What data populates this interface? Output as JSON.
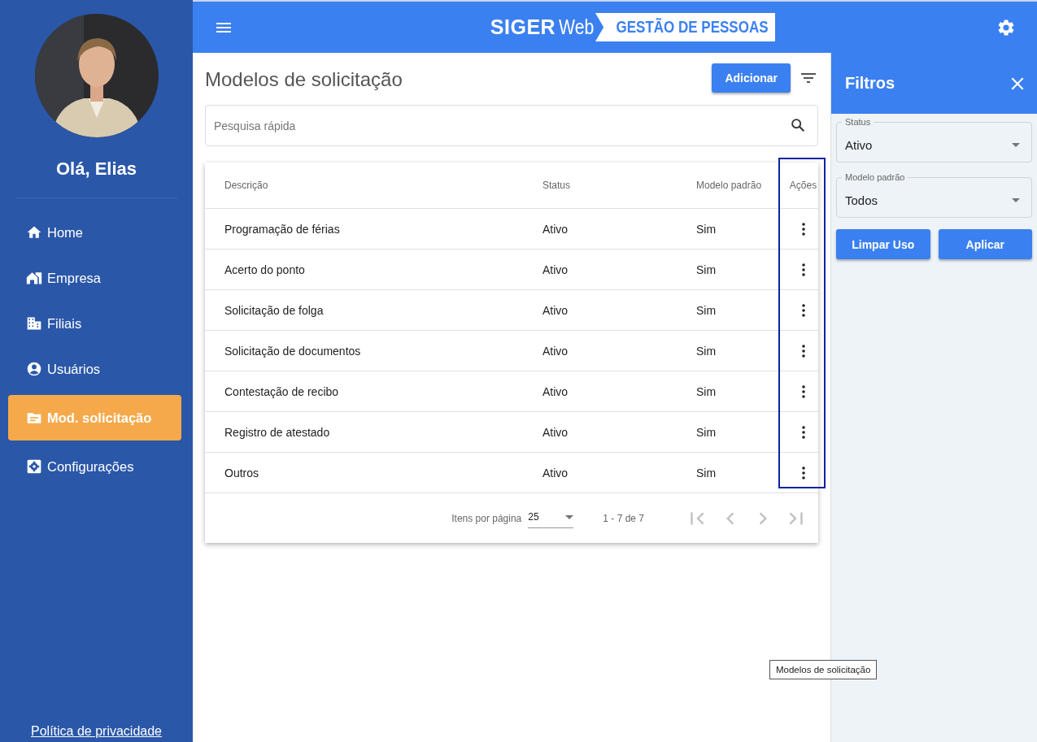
{
  "sidebar": {
    "greeting": "Olá, Elias",
    "items": [
      {
        "label": "Home",
        "selected": false
      },
      {
        "label": "Empresa",
        "selected": false
      },
      {
        "label": "Filiais",
        "selected": false
      },
      {
        "label": "Usuários",
        "selected": false
      },
      {
        "label": "Mod. solicitação",
        "selected": true
      },
      {
        "label": "Configurações",
        "selected": false
      }
    ],
    "footer_link": "Política de privacidade"
  },
  "header": {
    "brand": "SIGER",
    "brand_suffix": "Web",
    "product": "GESTÃO DE PESSOAS"
  },
  "page": {
    "title": "Modelos de solicitação",
    "add_button": "Adicionar",
    "search": {
      "placeholder": "Pesquisa rápida"
    }
  },
  "table": {
    "columns": [
      "Descrição",
      "Status",
      "Modelo padrão",
      "Ações"
    ],
    "rows": [
      [
        "Programação de férias",
        "Ativo",
        "Sim"
      ],
      [
        "Acerto do ponto",
        "Ativo",
        "Sim"
      ],
      [
        "Solicitação de folga",
        "Ativo",
        "Sim"
      ],
      [
        "Solicitação de documentos",
        "Ativo",
        "Sim"
      ],
      [
        "Contestação de recibo",
        "Ativo",
        "Sim"
      ],
      [
        "Registro de atestado",
        "Ativo",
        "Sim"
      ],
      [
        "Outros",
        "Ativo",
        "Sim"
      ]
    ],
    "paginator": {
      "page_size_label": "Itens por página",
      "page_size": "25",
      "range": "1 - 7 de 7"
    }
  },
  "filters": {
    "title": "Filtros",
    "fields": [
      {
        "label": "Status",
        "value": "Ativo"
      },
      {
        "label": "Modelo padrão",
        "value": "Todos"
      }
    ],
    "buttons": [
      "Limpar Uso",
      "Aplicar"
    ]
  },
  "tooltip": "Modelos de solicitação"
}
